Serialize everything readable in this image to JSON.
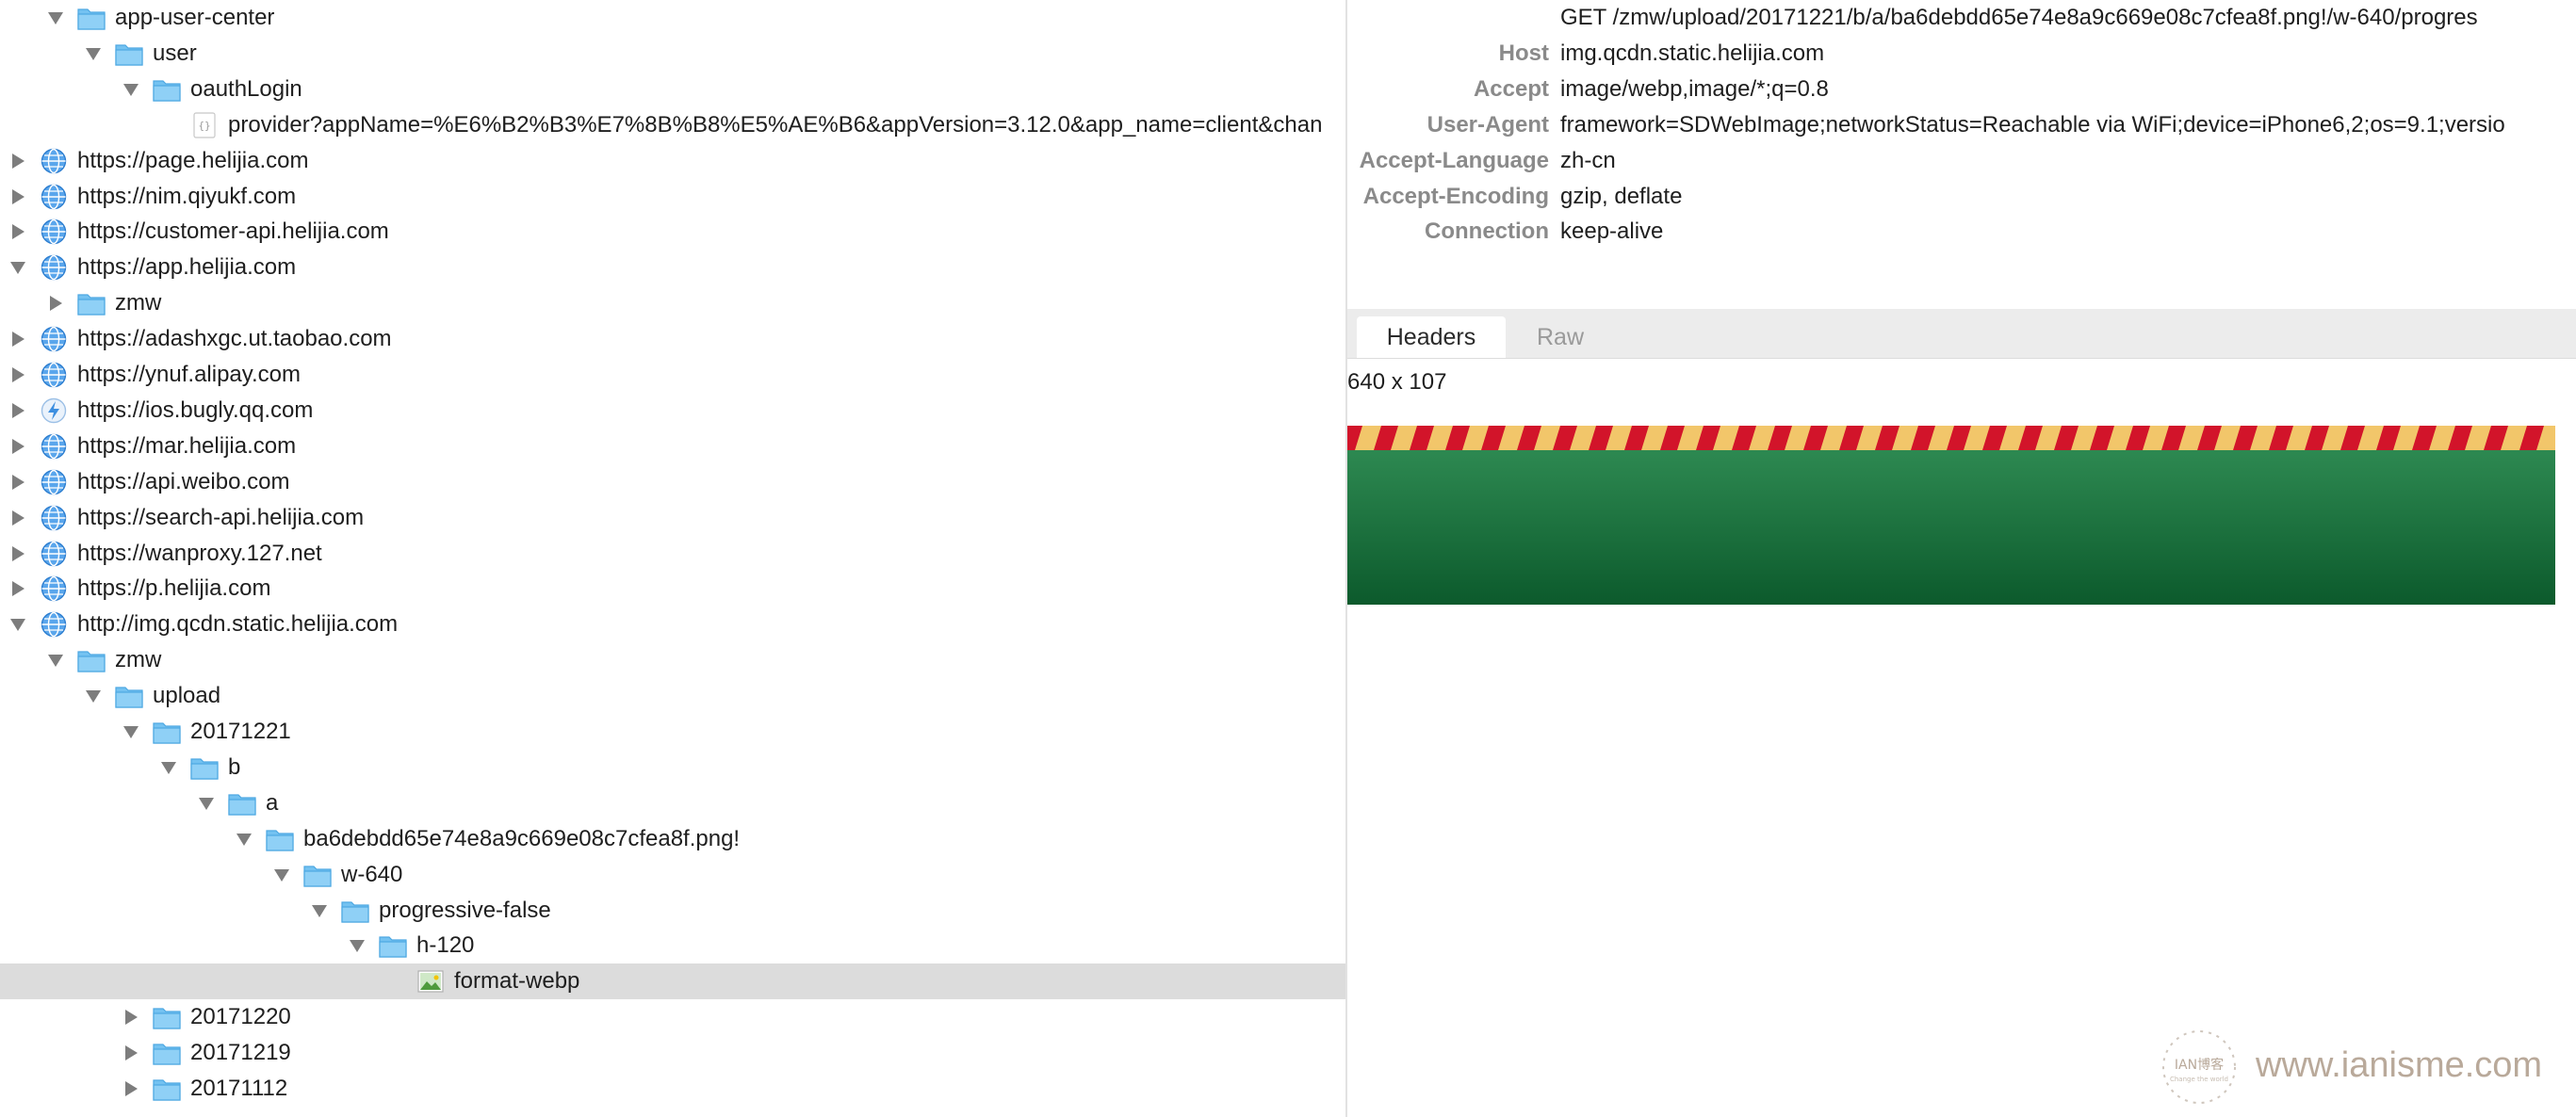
{
  "tree": [
    {
      "label": "app-user-center",
      "depth": 1,
      "state": "expanded",
      "icon": "folder-icon"
    },
    {
      "label": "user",
      "depth": 2,
      "state": "expanded",
      "icon": "folder-icon"
    },
    {
      "label": "oauthLogin",
      "depth": 3,
      "state": "expanded",
      "icon": "folder-icon"
    },
    {
      "label": "provider?appName=%E6%B2%B3%E7%8B%B8%E5%AE%B6&appVersion=3.12.0&app_name=client&chan",
      "depth": 4,
      "state": "leaf",
      "icon": "json-file-icon"
    },
    {
      "label": "https://page.helijia.com",
      "depth": 0,
      "state": "collapsed",
      "icon": "globe-icon"
    },
    {
      "label": "https://nim.qiyukf.com",
      "depth": 0,
      "state": "collapsed",
      "icon": "globe-icon"
    },
    {
      "label": "https://customer-api.helijia.com",
      "depth": 0,
      "state": "collapsed",
      "icon": "globe-icon"
    },
    {
      "label": "https://app.helijia.com",
      "depth": 0,
      "state": "expanded",
      "icon": "globe-icon"
    },
    {
      "label": "zmw",
      "depth": 1,
      "state": "collapsed",
      "icon": "folder-icon"
    },
    {
      "label": "https://adashxgc.ut.taobao.com",
      "depth": 0,
      "state": "collapsed",
      "icon": "globe-icon"
    },
    {
      "label": "https://ynuf.alipay.com",
      "depth": 0,
      "state": "collapsed",
      "icon": "globe-icon"
    },
    {
      "label": "https://ios.bugly.qq.com",
      "depth": 0,
      "state": "collapsed",
      "icon": "lightning-icon"
    },
    {
      "label": "https://mar.helijia.com",
      "depth": 0,
      "state": "collapsed",
      "icon": "globe-icon"
    },
    {
      "label": "https://api.weibo.com",
      "depth": 0,
      "state": "collapsed",
      "icon": "globe-icon"
    },
    {
      "label": "https://search-api.helijia.com",
      "depth": 0,
      "state": "collapsed",
      "icon": "globe-icon"
    },
    {
      "label": "https://wanproxy.127.net",
      "depth": 0,
      "state": "collapsed",
      "icon": "globe-icon"
    },
    {
      "label": "https://p.helijia.com",
      "depth": 0,
      "state": "collapsed",
      "icon": "globe-icon"
    },
    {
      "label": "http://img.qcdn.static.helijia.com",
      "depth": 0,
      "state": "expanded",
      "icon": "globe-icon"
    },
    {
      "label": "zmw",
      "depth": 1,
      "state": "expanded",
      "icon": "folder-icon"
    },
    {
      "label": "upload",
      "depth": 2,
      "state": "expanded",
      "icon": "folder-icon"
    },
    {
      "label": "20171221",
      "depth": 3,
      "state": "expanded",
      "icon": "folder-icon"
    },
    {
      "label": "b",
      "depth": 4,
      "state": "expanded",
      "icon": "folder-icon"
    },
    {
      "label": "a",
      "depth": 5,
      "state": "expanded",
      "icon": "folder-icon"
    },
    {
      "label": "ba6debdd65e74e8a9c669e08c7cfea8f.png!",
      "depth": 6,
      "state": "expanded",
      "icon": "folder-icon"
    },
    {
      "label": "w-640",
      "depth": 7,
      "state": "expanded",
      "icon": "folder-icon"
    },
    {
      "label": "progressive-false",
      "depth": 8,
      "state": "expanded",
      "icon": "folder-icon"
    },
    {
      "label": "h-120",
      "depth": 9,
      "state": "expanded",
      "icon": "folder-icon"
    },
    {
      "label": "format-webp",
      "depth": 10,
      "state": "leaf",
      "icon": "image-file-icon",
      "selected": true
    },
    {
      "label": "20171220",
      "depth": 3,
      "state": "collapsed",
      "icon": "folder-icon"
    },
    {
      "label": "20171219",
      "depth": 3,
      "state": "collapsed",
      "icon": "folder-icon"
    },
    {
      "label": "20171112",
      "depth": 3,
      "state": "collapsed",
      "icon": "folder-icon"
    }
  ],
  "request_headers": [
    {
      "key": "",
      "value": "GET /zmw/upload/20171221/b/a/ba6debdd65e74e8a9c669e08c7cfea8f.png!/w-640/progres"
    },
    {
      "key": "Host",
      "value": "img.qcdn.static.helijia.com"
    },
    {
      "key": "Accept",
      "value": "image/webp,image/*;q=0.8"
    },
    {
      "key": "User-Agent",
      "value": "framework=SDWebImage;networkStatus=Reachable via WiFi;device=iPhone6,2;os=9.1;versio"
    },
    {
      "key": "Accept-Language",
      "value": "zh-cn"
    },
    {
      "key": "Accept-Encoding",
      "value": "gzip, deflate"
    },
    {
      "key": "Connection",
      "value": "keep-alive"
    }
  ],
  "tabs": {
    "headers_label": "Headers",
    "raw_label": "Raw",
    "active": "Headers"
  },
  "image_preview": {
    "dimensions": "640 x 107"
  },
  "watermark": {
    "text": "www.ianisme.com"
  },
  "colors": {
    "folder": "#74c2f1",
    "folder_dark": "#4da8e2",
    "globe": "#3d8fe0",
    "selection": "#dcdcdc",
    "preview_green_top": "#2e8a52",
    "preview_green_bottom": "#0c5a2c",
    "preview_stripe_red": "#d2142a",
    "preview_stripe_gold": "#f2c66a"
  }
}
